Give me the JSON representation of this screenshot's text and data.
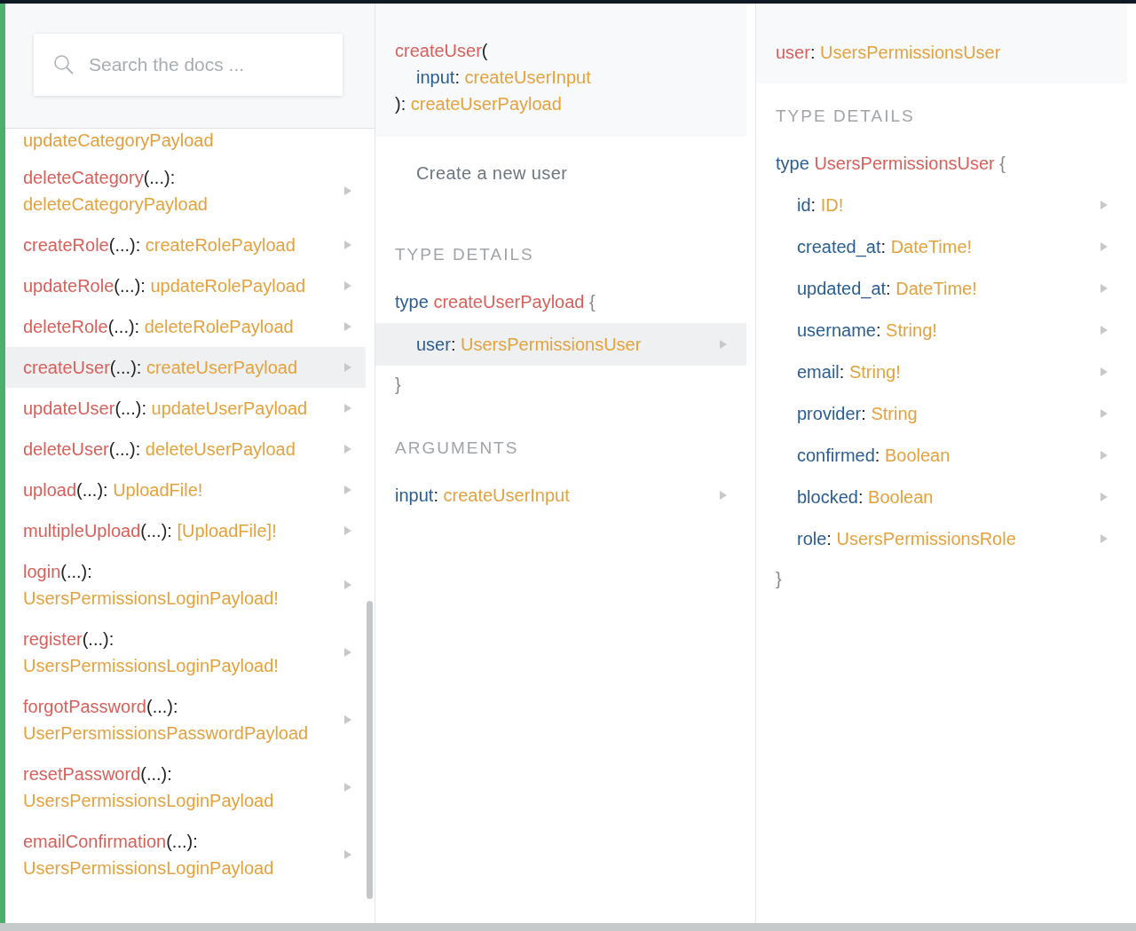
{
  "search": {
    "placeholder": "Search the docs ..."
  },
  "sidebar": {
    "partial_item_type": "updateCategoryPayload",
    "items": [
      {
        "name": "deleteCategory",
        "args": "(...):",
        "type": "deleteCategoryPayload",
        "selected": false
      },
      {
        "name": "createRole",
        "args": "(...):",
        "type": "createRolePayload",
        "selected": false
      },
      {
        "name": "updateRole",
        "args": "(...):",
        "type": "updateRolePayload",
        "selected": false
      },
      {
        "name": "deleteRole",
        "args": "(...):",
        "type": "deleteRolePayload",
        "selected": false
      },
      {
        "name": "createUser",
        "args": "(...):",
        "type": "createUserPayload",
        "selected": true
      },
      {
        "name": "updateUser",
        "args": "(...):",
        "type": "updateUserPayload",
        "selected": false
      },
      {
        "name": "deleteUser",
        "args": "(...):",
        "type": "deleteUserPayload",
        "selected": false
      },
      {
        "name": "upload",
        "args": "(...):",
        "type": "UploadFile!",
        "selected": false
      },
      {
        "name": "multipleUpload",
        "args": "(...):",
        "type": "[UploadFile]!",
        "selected": false
      },
      {
        "name": "login",
        "args": "(...):",
        "type": "UsersPermissionsLoginPayload!",
        "selected": false
      },
      {
        "name": "register",
        "args": "(...):",
        "type": "UsersPermissionsLoginPayload!",
        "selected": false
      },
      {
        "name": "forgotPassword",
        "args": "(...):",
        "type": "UserPersmissionsPasswordPayload",
        "selected": false
      },
      {
        "name": "resetPassword",
        "args": "(...):",
        "type": "UsersPermissionsLoginPayload",
        "selected": false
      },
      {
        "name": "emailConfirmation",
        "args": "(...):",
        "type": "UsersPermissionsLoginPayload",
        "selected": false
      }
    ]
  },
  "middle": {
    "signature": {
      "name": "createUser",
      "open": "(",
      "arg_name": "input",
      "arg_sep": ":",
      "arg_type": "createUserInput",
      "close": "):",
      "return_type": "createUserPayload"
    },
    "description": "Create a new user",
    "type_details": {
      "heading": "TYPE DETAILS",
      "keyword": "type",
      "type_name": "createUserPayload",
      "open": "{",
      "close": "}",
      "fields": [
        {
          "name": "user",
          "sep": ":",
          "type": "UsersPermissionsUser",
          "selected": true
        }
      ]
    },
    "arguments": {
      "heading": "ARGUMENTS",
      "items": [
        {
          "name": "input",
          "sep": ":",
          "type": "createUserInput"
        }
      ]
    }
  },
  "right": {
    "header": {
      "name": "user",
      "sep": ":",
      "type": "UsersPermissionsUser"
    },
    "type_details": {
      "heading": "TYPE DETAILS",
      "keyword": "type",
      "type_name": "UsersPermissionsUser",
      "open": "{",
      "close": "}",
      "fields": [
        {
          "name": "id",
          "sep": ":",
          "type": "ID!",
          "selected": false
        },
        {
          "name": "created_at",
          "sep": ":",
          "type": "DateTime!",
          "selected": false
        },
        {
          "name": "updated_at",
          "sep": ":",
          "type": "DateTime!",
          "selected": false
        },
        {
          "name": "username",
          "sep": ":",
          "type": "String!",
          "selected": false
        },
        {
          "name": "email",
          "sep": ":",
          "type": "String!",
          "selected": false
        },
        {
          "name": "provider",
          "sep": ":",
          "type": "String",
          "selected": false
        },
        {
          "name": "confirmed",
          "sep": ":",
          "type": "Boolean",
          "selected": false
        },
        {
          "name": "blocked",
          "sep": ":",
          "type": "Boolean",
          "selected": false
        },
        {
          "name": "role",
          "sep": ":",
          "type": "UsersPermissionsRole",
          "selected": false
        }
      ]
    }
  }
}
